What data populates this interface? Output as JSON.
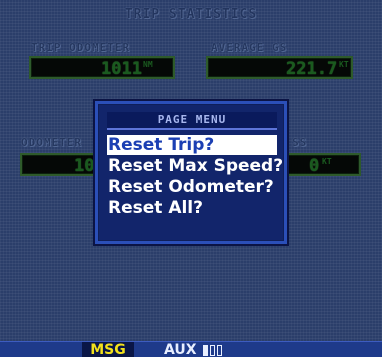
{
  "page": {
    "title": "TRIP STATISTICS"
  },
  "fields": {
    "trip_odometer": {
      "label": "TRIP ODOMETER",
      "value": "1011",
      "unit": "NM"
    },
    "average_gs": {
      "label": "AVERAGE GS",
      "value": "221.7",
      "unit": "KT"
    },
    "odometer": {
      "label": "ODOMETER",
      "value": "10"
    },
    "max_speed": {
      "label": "SS",
      "value": "0",
      "unit": "KT"
    }
  },
  "menu": {
    "title": "PAGE MENU",
    "items": [
      {
        "label": "Reset Trip?",
        "selected": true
      },
      {
        "label": "Reset Max Speed?",
        "selected": false
      },
      {
        "label": "Reset Odometer?",
        "selected": false
      },
      {
        "label": "Reset All?",
        "selected": false
      }
    ]
  },
  "status_bar": {
    "msg_label": "MSG",
    "aux_label": "AUX",
    "msg_color": "#f2e11b",
    "page_count": 3,
    "active_page": 0
  },
  "colors": {
    "background": "#2b3e6a",
    "field_text": "#1a5a1f",
    "menu_background": "#12256b",
    "menu_highlight": "#ffffff",
    "status_bar": "#1e3a8a"
  }
}
